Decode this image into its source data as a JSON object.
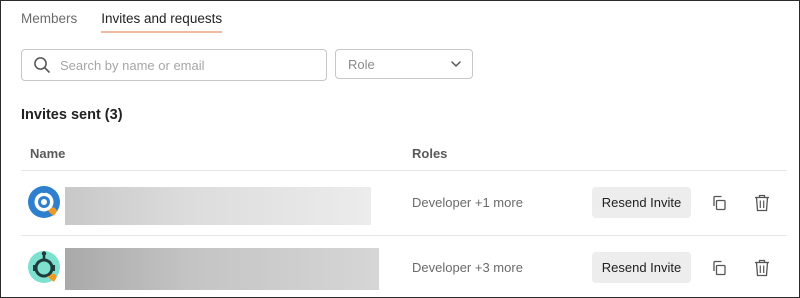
{
  "tabs": [
    {
      "label": "Members",
      "active": false
    },
    {
      "label": "Invites and requests",
      "active": true
    }
  ],
  "search": {
    "placeholder": "Search by name or email",
    "value": ""
  },
  "role_filter": {
    "label": "Role"
  },
  "section": {
    "title": "Invites sent (3)"
  },
  "table": {
    "headers": {
      "name": "Name",
      "roles": "Roles"
    },
    "rows": [
      {
        "roles": "Developer +1 more",
        "action_label": "Resend Invite",
        "avatar": "robot-avatar-blue"
      },
      {
        "roles": "Developer +3 more",
        "action_label": "Resend Invite",
        "avatar": "robot-avatar-teal"
      }
    ]
  },
  "colors": {
    "accent_underline": "#f1b9a1",
    "avatar_blue": "#2f7fcf",
    "avatar_teal": "#7ee0cf",
    "badge_orange": "#f09a24"
  }
}
